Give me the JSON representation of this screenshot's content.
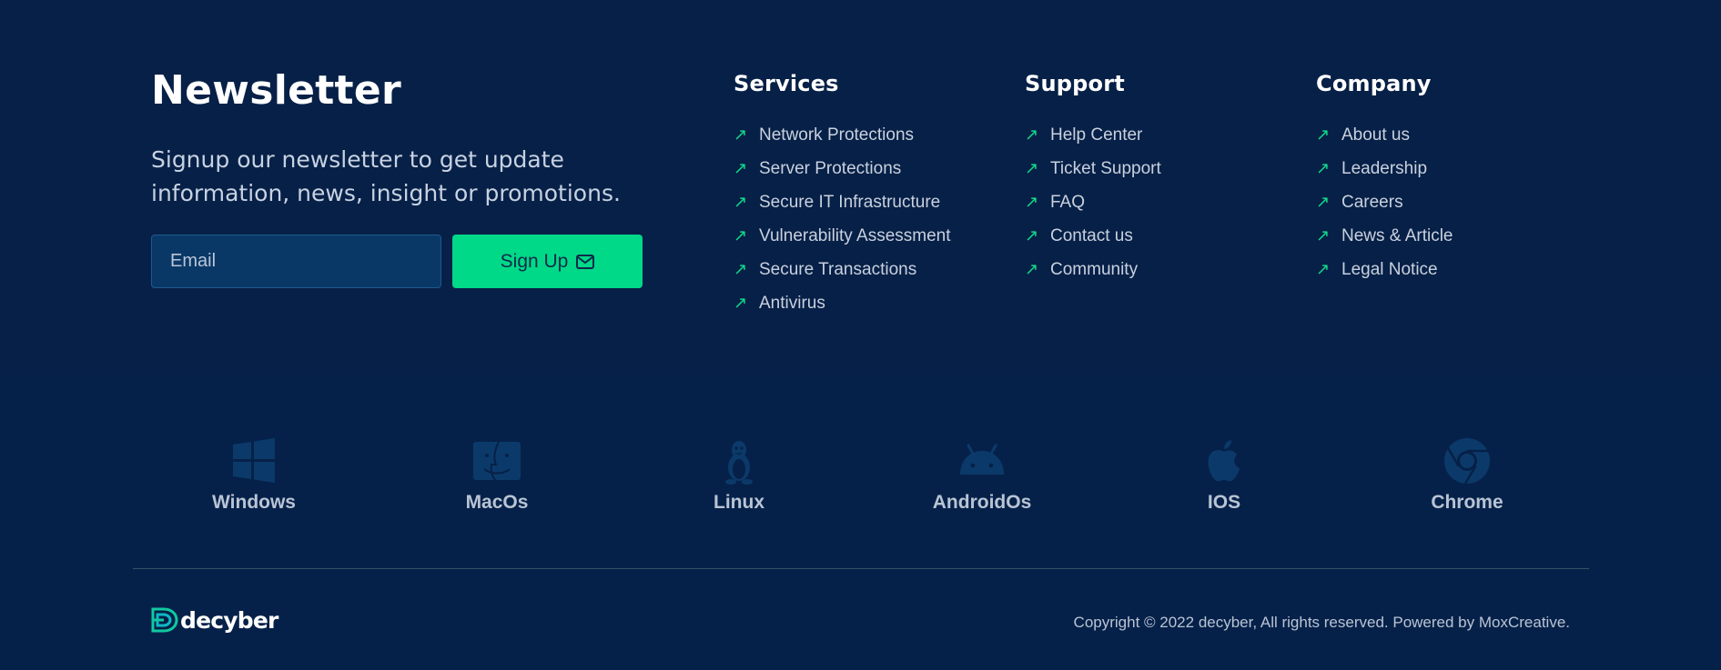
{
  "newsletter": {
    "title": "Newsletter",
    "description": "Signup our newsletter to get update information, news, insight or promotions.",
    "email_placeholder": "Email",
    "signup_label": "Sign Up",
    "signup_icon": "envelope-icon"
  },
  "columns": [
    {
      "heading": "Services",
      "links": [
        "Network Protections",
        "Server Protections",
        "Secure IT Infrastructure",
        "Vulnerability Assessment",
        "Secure Transactions",
        "Antivirus"
      ]
    },
    {
      "heading": "Support",
      "links": [
        "Help Center",
        "Ticket Support",
        "FAQ",
        "Contact us",
        "Community"
      ]
    },
    {
      "heading": "Company",
      "links": [
        "About us",
        "Leadership",
        "Careers",
        "News & Article",
        "Legal Notice"
      ]
    }
  ],
  "link_icon": "arrow-up-right-icon",
  "platforms": [
    {
      "label": "Windows",
      "icon": "windows-icon"
    },
    {
      "label": "MacOs",
      "icon": "macos-finder-icon"
    },
    {
      "label": "Linux",
      "icon": "linux-tux-icon"
    },
    {
      "label": "AndroidOs",
      "icon": "android-icon"
    },
    {
      "label": "IOS",
      "icon": "apple-icon"
    },
    {
      "label": "Chrome",
      "icon": "chrome-icon"
    }
  ],
  "footer": {
    "logo_text": "decyber",
    "copyright": "Copyright © 2022 decyber, All rights reserved. Powered by MoxCreative."
  },
  "colors": {
    "background": "#072047",
    "accent": "#00d987",
    "platform_icon": "#0b3a6a",
    "text_muted": "#c8d1de"
  }
}
